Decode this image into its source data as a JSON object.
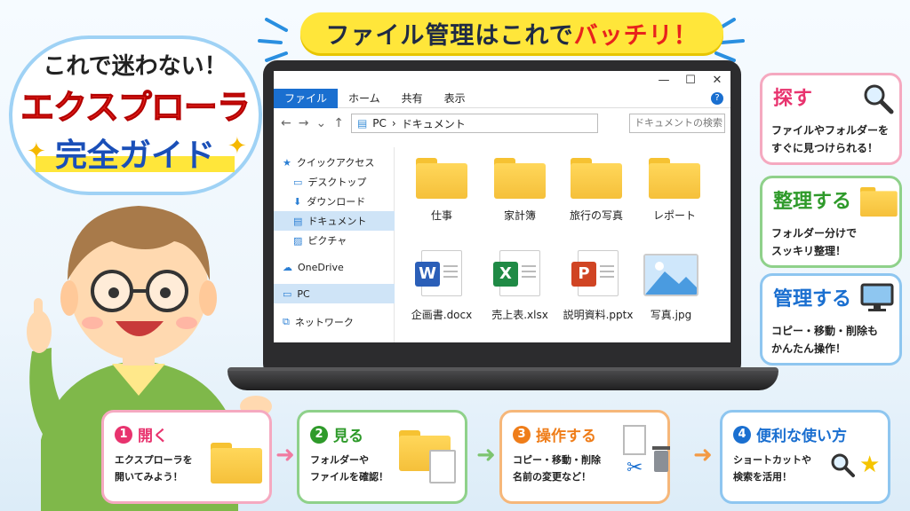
{
  "banner": {
    "text_main": "ファイル管理はこれで",
    "text_accent": "バッチリ！"
  },
  "title": {
    "line1": "これで迷わない！",
    "line2": "エクスプローラ",
    "line3": "完全ガイド",
    "sparkle": "✦"
  },
  "explorer": {
    "window_controls": {
      "minimize": "—",
      "maximize": "☐",
      "close": "✕"
    },
    "ribbon_tabs": [
      "ファイル",
      "ホーム",
      "共有",
      "表示"
    ],
    "path": [
      "PC",
      "ドキュメント"
    ],
    "search_placeholder": "ドキュメントの検索",
    "sidebar": [
      {
        "label": "クイックアクセス",
        "icon": "star-icon"
      },
      {
        "label": "デスクトップ",
        "icon": "desktop-icon"
      },
      {
        "label": "ダウンロード",
        "icon": "download-icon"
      },
      {
        "label": "ドキュメント",
        "icon": "document-icon"
      },
      {
        "label": "ピクチャ",
        "icon": "picture-icon"
      },
      {
        "label": "OneDrive",
        "icon": "cloud-icon"
      },
      {
        "label": "PC",
        "icon": "pc-icon"
      },
      {
        "label": "ネットワーク",
        "icon": "network-icon"
      }
    ],
    "folders": [
      "仕事",
      "家計簿",
      "旅行の写真",
      "レポート"
    ],
    "files": [
      {
        "name": "企画書.docx",
        "badge": "W",
        "color": "#2b5fb8"
      },
      {
        "name": "売上表.xlsx",
        "badge": "X",
        "color": "#1f8a45"
      },
      {
        "name": "説明資料.pptx",
        "badge": "P",
        "color": "#d04423"
      },
      {
        "name": "写真.jpg",
        "badge": "",
        "color": "#3b8fd8"
      }
    ]
  },
  "cards": [
    {
      "title": "探す",
      "desc1": "ファイルやフォルダーを",
      "desc2": "すぐに見つけられる！"
    },
    {
      "title": "整理する",
      "desc1": "フォルダー分けで",
      "desc2": "スッキリ整理！"
    },
    {
      "title": "管理する",
      "desc1": "コピー・移動・削除も",
      "desc2": "かんたん操作！"
    }
  ],
  "steps": [
    {
      "num": "1",
      "title": "開く",
      "desc1": "エクスプローラを",
      "desc2": "開いてみよう！"
    },
    {
      "num": "2",
      "title": "見る",
      "desc1": "フォルダーや",
      "desc2": "ファイルを確認！"
    },
    {
      "num": "3",
      "title": "操作する",
      "desc1": "コピー・移動・削除",
      "desc2": "名前の変更など！"
    },
    {
      "num": "4",
      "title": "便利な使い方",
      "desc1": "ショートカットや",
      "desc2": "検索を活用！"
    }
  ],
  "colors": {
    "accent_red": "#e8231c",
    "accent_blue": "#1a6fd0",
    "banner_yellow": "#ffe63a"
  }
}
